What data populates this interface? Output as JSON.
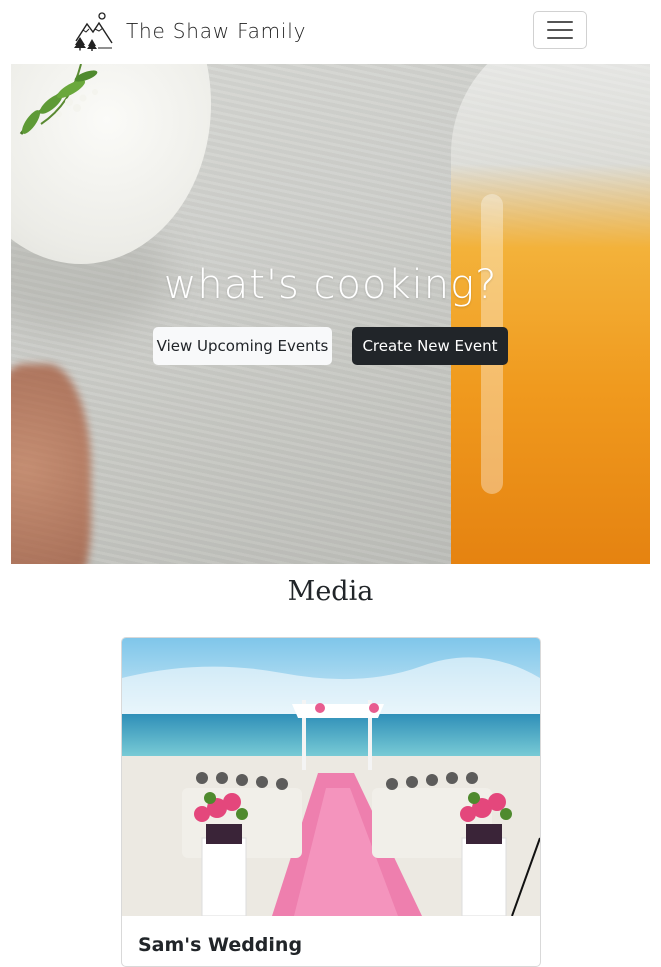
{
  "navbar": {
    "brand_name": "The Shaw Family",
    "logo_icon": "mountains-trees-logo",
    "menu_icon": "hamburger-menu-icon"
  },
  "hero": {
    "title": "what's cooking?",
    "buttons": {
      "view_events": "View Upcoming Events",
      "create_event": "Create New Event"
    }
  },
  "media": {
    "heading": "Media",
    "cards": [
      {
        "title": "Sam's Wedding",
        "image_description": "beach wedding aisle with flowers"
      }
    ]
  },
  "colors": {
    "dark_button": "#212529",
    "light_button": "#f8f9fa",
    "accent_orange": "#f09a1e"
  }
}
